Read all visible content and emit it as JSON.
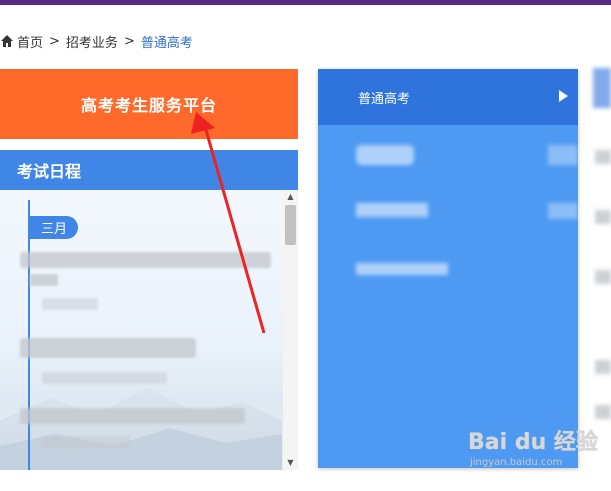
{
  "breadcrumb": {
    "items": [
      "首页",
      "招考业务",
      "普通高考"
    ],
    "separator": ">"
  },
  "platform_button": {
    "label": "高考考生服务平台"
  },
  "schedule": {
    "title": "考试日程",
    "month": "三月"
  },
  "right_menu": {
    "active_item": "普通高考"
  },
  "watermark": {
    "logo": "Bai du 经验",
    "url": "jingyan.baidu.com"
  },
  "colors": {
    "top_bar": "#5b2a86",
    "platform_button": "#ff6a2b",
    "schedule_header": "#3f86e6",
    "menu_panel": "#4e9af3",
    "menu_active": "#2f74dc",
    "annotation_arrow": "#ee2222",
    "link": "#2f6fd6"
  }
}
